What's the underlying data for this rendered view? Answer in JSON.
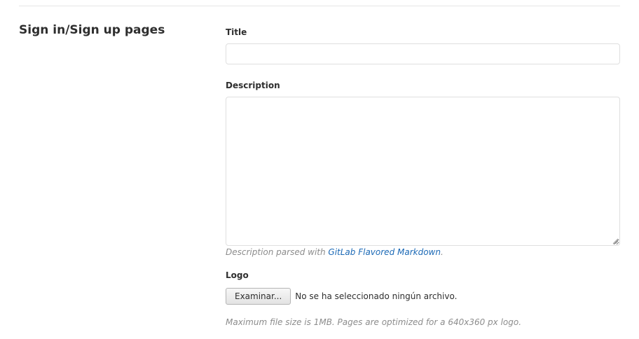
{
  "section": {
    "title": "Sign in/Sign up pages"
  },
  "form": {
    "title_label": "Title",
    "title_value": "",
    "description_label": "Description",
    "description_value": "",
    "description_help_prefix": "Description parsed with ",
    "description_help_link": "GitLab Flavored Markdown",
    "description_help_suffix": ".",
    "logo_label": "Logo",
    "logo_button_label": "Examinar...",
    "logo_file_status": "No se ha seleccionado ningún archivo.",
    "logo_help": "Maximum file size is 1MB. Pages are optimized for a 640x360 px logo."
  },
  "icons": {
    "resize_grip": "resize-grip-icon"
  },
  "colors": {
    "link": "#1b69b6",
    "help_text": "#8c8c8c",
    "border": "#dfdfdf"
  }
}
